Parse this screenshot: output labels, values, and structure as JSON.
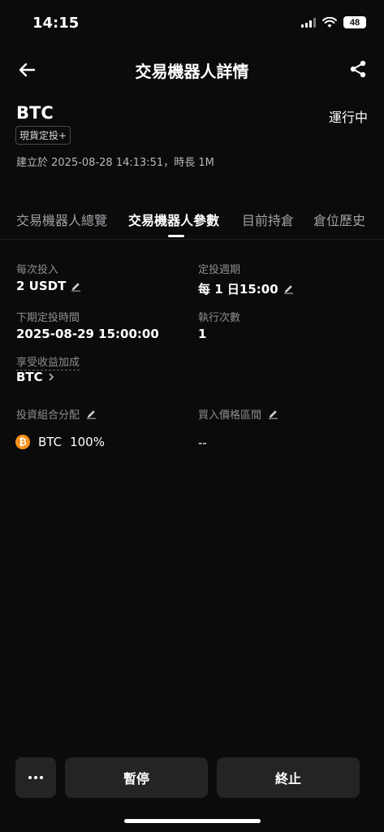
{
  "status_bar": {
    "time": "14:15",
    "battery": "48"
  },
  "header": {
    "title": "交易機器人詳情"
  },
  "bot": {
    "coin": "BTC",
    "status": "運行中",
    "tag": "現貨定投+",
    "created": "建立於 2025-08-28 14:13:51，時長 1M"
  },
  "tabs": [
    "交易機器人總覽",
    "交易機器人參數",
    "目前持倉",
    "倉位歷史"
  ],
  "active_tab_index": 1,
  "params": {
    "per_invest_label": "每次投入",
    "per_invest_value": "2 USDT",
    "cycle_label": "定投週期",
    "cycle_value": "每 1 日15:00",
    "next_time_label": "下期定投時間",
    "next_time_value": "2025-08-29 15:00:00",
    "exec_count_label": "執行次數",
    "exec_count_value": "1",
    "earn_label": "享受收益加成",
    "earn_value": "BTC",
    "portfolio_label": "投資組合分配",
    "portfolio_coin": "BTC",
    "portfolio_pct": "100%",
    "price_range_label": "買入價格區間",
    "price_range_value": "--"
  },
  "buttons": {
    "pause": "暫停",
    "stop": "終止"
  },
  "colors": {
    "background": "#0b0b0b",
    "btc_orange": "#f7931a",
    "button_bg": "#242424"
  },
  "icons": [
    "back-arrow-icon",
    "share-icon",
    "edit-icon",
    "chevron-right-icon",
    "btc-icon",
    "more-icon"
  ]
}
